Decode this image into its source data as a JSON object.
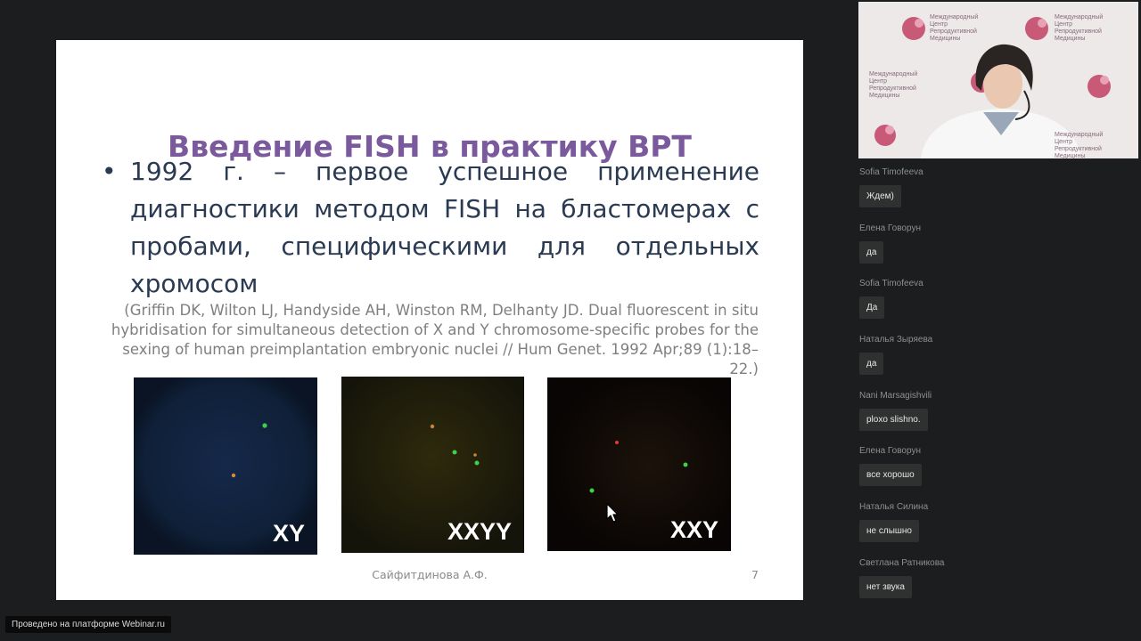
{
  "slide": {
    "title": "Введение FISH в практику ВРТ",
    "bullet": "•",
    "bullet_text": "1992 г. – первое успешное применение диагностики методом FISH на бластомерах с пробами, специфическими для отдельных хромосом",
    "reference": "(Griffin DK, Wilton LJ, Handyside AH, Winston RM, Delhanty JD. Dual fluorescent in situ hybridisation for simultaneous detection of X and Y chromosome-specific probes for the sexing of human preimplantation embryonic nuclei // Hum Genet. 1992 Apr;89 (1):18–22.)",
    "images": [
      {
        "label": "XY"
      },
      {
        "label": "XXYY"
      },
      {
        "label": "XXY"
      }
    ],
    "author": "Сайфитдинова А.Ф.",
    "page_number": "7"
  },
  "video": {
    "logo_lines": [
      "Международный",
      "Центр",
      "Репродуктивной",
      "Медицины"
    ]
  },
  "chat": {
    "messages": [
      {
        "author": "Sofia Timofeeva",
        "text": "Ждем)"
      },
      {
        "author": "Елена Говорун",
        "text": "да"
      },
      {
        "author": "Sofia Timofeeva",
        "text": "Да"
      },
      {
        "author": "Наталья Зыряева",
        "text": "да"
      },
      {
        "author": "Nani Marsagishvili",
        "text": "ploxo slishno."
      },
      {
        "author": "Елена Говорун",
        "text": "все хорошо"
      },
      {
        "author": "Наталья Силина",
        "text": "не слышно"
      },
      {
        "author": "Светлана Ратникова",
        "text": "нет звука"
      }
    ]
  },
  "platform": {
    "badge": "Проведено на платформе Webinar.ru"
  },
  "colors": {
    "title": "#7a5a9c",
    "body_text": "#2a3a52",
    "background": "#1c1d1e",
    "chat_bubble": "#2f3030"
  },
  "icons": [
    "cursor-arrow-icon",
    "clinic-logo-icon"
  ]
}
